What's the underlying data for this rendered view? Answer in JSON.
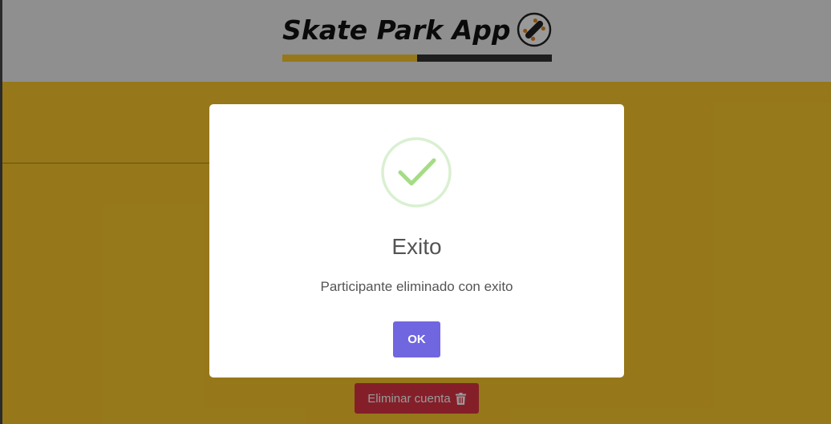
{
  "header": {
    "app_title": "Skate Park App",
    "logo_icon": "skateboard-icon",
    "progress_fraction": 0.5,
    "progress_fill_color": "#fac92c",
    "progress_track_color": "#333333"
  },
  "main": {
    "background_color": "#fac92c",
    "delete_account_label": "Eliminar cuenta",
    "delete_account_icon": "trash-icon",
    "delete_color": "#dc3545"
  },
  "modal": {
    "icon": "success-check-icon",
    "title": "Exito",
    "message": "Participante eliminado con exito",
    "confirm_label": "OK",
    "confirm_color": "#7066e0"
  }
}
